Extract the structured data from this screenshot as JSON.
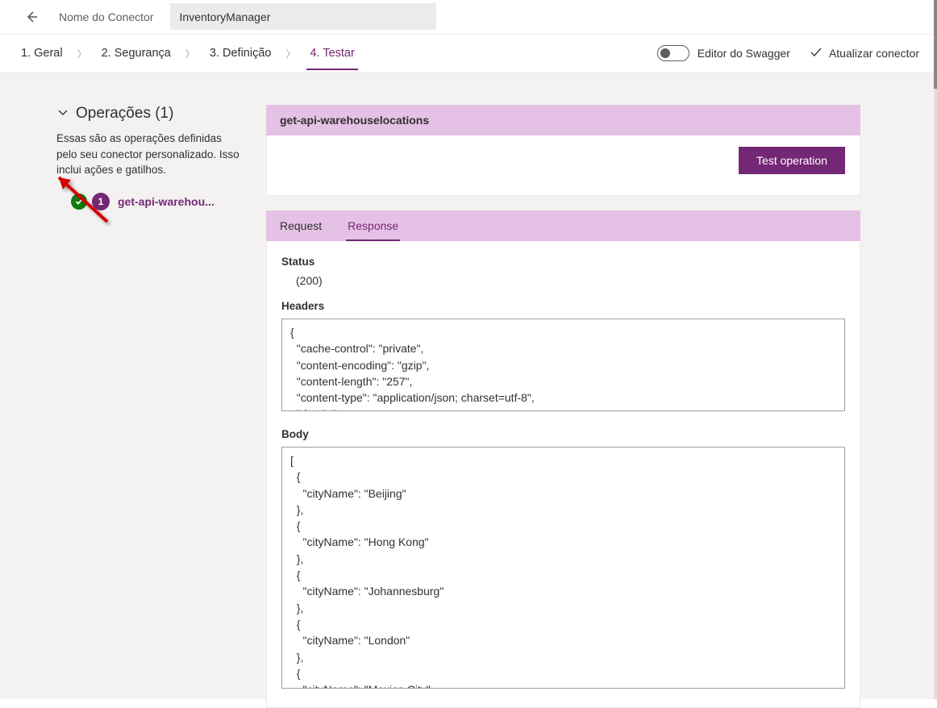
{
  "header": {
    "name_label": "Nome do Conector",
    "connector_name": "InventoryManager"
  },
  "steps": {
    "s1": "1. Geral",
    "s2": "2. Segurança",
    "s3": "3. Definição",
    "s4": "4. Testar",
    "swagger_label": "Editor do Swagger",
    "update_label": "Atualizar conector"
  },
  "sidebar": {
    "title": "Operações (1)",
    "desc": "Essas são as operações definidas pelo seu conector personalizado. Isso inclui ações e gatilhos.",
    "op_index": "1",
    "op_name": "get-api-warehou..."
  },
  "main": {
    "operation_full": "get-api-warehouselocations",
    "test_button": "Test operation",
    "tab_request": "Request",
    "tab_response": "Response",
    "status_label": "Status",
    "status_value": "(200)",
    "headers_label": "Headers",
    "headers_text": "{\n  \"cache-control\": \"private\",\n  \"content-encoding\": \"gzip\",\n  \"content-length\": \"257\",\n  \"content-type\": \"application/json; charset=utf-8\",\n  \"date\": \"",
    "body_label": "Body",
    "body_text": "[\n  {\n    \"cityName\": \"Beijing\"\n  },\n  {\n    \"cityName\": \"Hong Kong\"\n  },\n  {\n    \"cityName\": \"Johannesburg\"\n  },\n  {\n    \"cityName\": \"London\"\n  },\n  {\n    \"cityName\": \"Mexico City\""
  }
}
